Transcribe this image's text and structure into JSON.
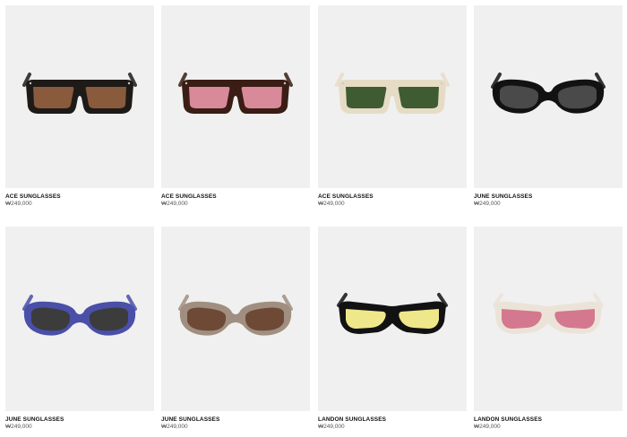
{
  "products": [
    {
      "name": "ACE SUNGLASSES",
      "price": "₩249,000",
      "frame": "#1d1a18",
      "lens": "#8a5a3c",
      "style": "square",
      "frame_material": "black acetate"
    },
    {
      "name": "ACE SUNGLASSES",
      "price": "₩249,000",
      "frame": "#3a1d14",
      "lens": "#d98a9a",
      "style": "square",
      "frame_material": "tortoise acetate"
    },
    {
      "name": "ACE SUNGLASSES",
      "price": "₩249,000",
      "frame": "#e6dcc6",
      "lens": "#3e5b32",
      "style": "square",
      "frame_material": "clear crystal acetate"
    },
    {
      "name": "JUNE SUNGLASSES",
      "price": "₩249,000",
      "frame": "#121212",
      "lens": "#4a4a4a",
      "style": "oval",
      "frame_material": "black acetate"
    },
    {
      "name": "JUNE SUNGLASSES",
      "price": "₩249,000",
      "frame": "#4a4fa8",
      "lens": "#3c3c3c",
      "style": "oval",
      "frame_material": "blue acetate"
    },
    {
      "name": "JUNE SUNGLASSES",
      "price": "₩249,000",
      "frame": "#a08f80",
      "lens": "#6e4a36",
      "style": "oval",
      "frame_material": "brown crystal acetate"
    },
    {
      "name": "LANDON SUNGLASSES",
      "price": "₩249,000",
      "frame": "#121212",
      "lens": "#efe88a",
      "style": "wrap",
      "frame_material": "black acetate"
    },
    {
      "name": "LANDON SUNGLASSES",
      "price": "₩249,000",
      "frame": "#ece3d8",
      "lens": "#d4788f",
      "style": "wrap",
      "frame_material": "ivory acetate"
    }
  ]
}
